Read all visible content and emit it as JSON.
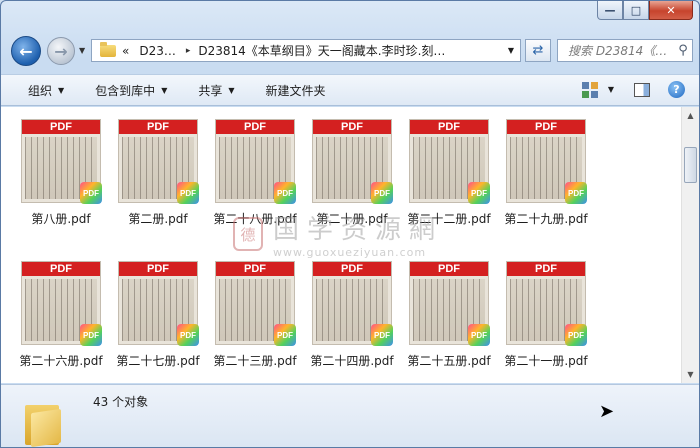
{
  "window": {
    "minimize_label": "—",
    "maximize_label": "□",
    "close_label": "✕"
  },
  "nav": {
    "back_icon": "arrow-left",
    "forward_icon": "arrow-right"
  },
  "address": {
    "prefix": "«",
    "crumbs": [
      "D23…",
      "D23814《本草纲目》天一阁藏本.李时珍.刻…"
    ],
    "separator": "▸"
  },
  "search": {
    "placeholder": "搜索 D23814《…"
  },
  "toolbar": {
    "items": [
      "组织",
      "包含到库中",
      "共享",
      "新建文件夹"
    ]
  },
  "files": [
    {
      "name": "第八册.pdf"
    },
    {
      "name": "第二册.pdf"
    },
    {
      "name": "第二十八册.pdf"
    },
    {
      "name": "第二十册.pdf"
    },
    {
      "name": "第二十二册.pdf"
    },
    {
      "name": "第二十九册.pdf"
    },
    {
      "name": "第二十六册.pdf"
    },
    {
      "name": "第二十七册.pdf"
    },
    {
      "name": "第二十三册.pdf"
    },
    {
      "name": "第二十四册.pdf"
    },
    {
      "name": "第二十五册.pdf"
    },
    {
      "name": "第二十一册.pdf"
    }
  ],
  "thumb": {
    "pdf_label": "PDF",
    "badge_label": "PDF"
  },
  "watermark": {
    "seal": "德",
    "text": "国学资源網",
    "url": "www.guoxueziyuan.com"
  },
  "details": {
    "count_text": "43 个对象"
  },
  "colors": {
    "pdf_red": "#d42020",
    "accent_blue": "#1d5fae"
  }
}
